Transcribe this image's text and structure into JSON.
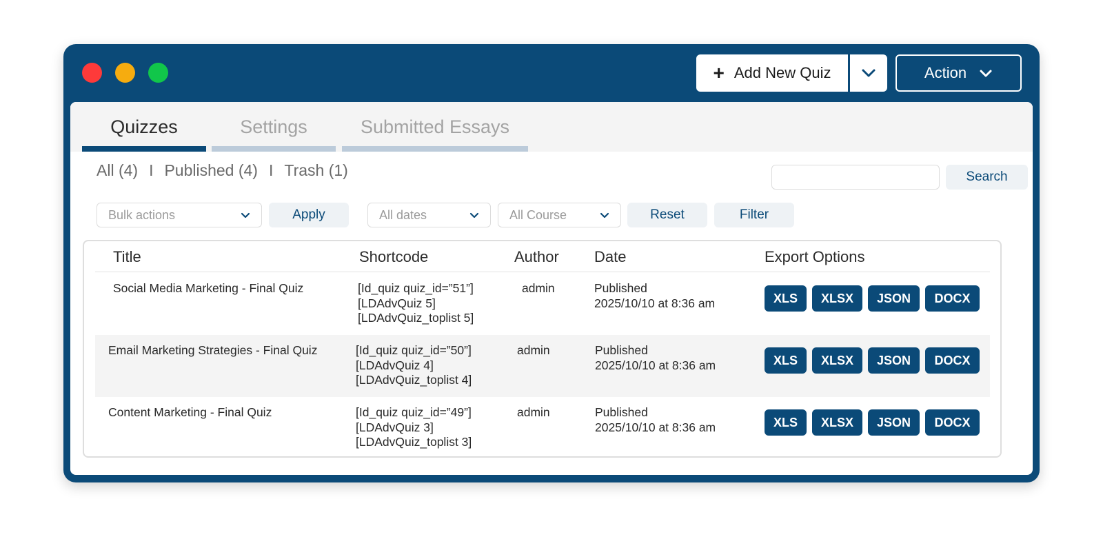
{
  "window": {
    "traffic_lights": [
      "close",
      "minimize",
      "maximize"
    ],
    "colors": {
      "frame": "#0b4a78",
      "close": "#fe3a3a",
      "minimize": "#f6ac0f",
      "maximize": "#11c64a"
    }
  },
  "toolbar": {
    "add_label": "Add New Quiz",
    "action_label": "Action"
  },
  "tabs": [
    {
      "label": "Quizzes",
      "active": true
    },
    {
      "label": "Settings",
      "active": false
    },
    {
      "label": "Submitted Essays",
      "active": false
    }
  ],
  "views": {
    "all": "All (4)",
    "published": "Published (4)",
    "trash": "Trash (1)",
    "separator": "I"
  },
  "search": {
    "value": "",
    "button_label": "Search"
  },
  "filters": {
    "bulk_actions": "Bulk actions",
    "apply_label": "Apply",
    "dates": "All dates",
    "course": "All Course",
    "reset_label": "Reset",
    "filter_label": "Filter"
  },
  "table": {
    "headers": {
      "title": "Title",
      "shortcode": "Shortcode",
      "author": "Author",
      "date": "Date",
      "export": "Export Options"
    },
    "export_buttons": {
      "xls": "XLS",
      "xlsx": "XLSX",
      "json": "JSON",
      "docx": "DOCX"
    },
    "rows": [
      {
        "title": "Social Media Marketing - Final Quiz",
        "shortcode": [
          "[Id_quiz quiz_id=”51”]",
          "[LDAdvQuiz 5]",
          "[LDAdvQuiz_toplist 5]"
        ],
        "author": "admin",
        "status": "Published",
        "date": "2025/10/10 at 8:36 am"
      },
      {
        "title": "Email Marketing Strategies - Final Quiz",
        "shortcode": [
          "[Id_quiz quiz_id=”50”]",
          "[LDAdvQuiz 4]",
          "[LDAdvQuiz_toplist 4]"
        ],
        "author": "admin",
        "status": "Published",
        "date": "2025/10/10 at 8:36 am"
      },
      {
        "title": "Content Marketing - Final Quiz",
        "shortcode": [
          "[Id_quiz quiz_id=”49”]",
          "[LDAdvQuiz 3]",
          "[LDAdvQuiz_toplist 3]"
        ],
        "author": "admin",
        "status": "Published",
        "date": "2025/10/10 at 8:36 am"
      }
    ]
  }
}
